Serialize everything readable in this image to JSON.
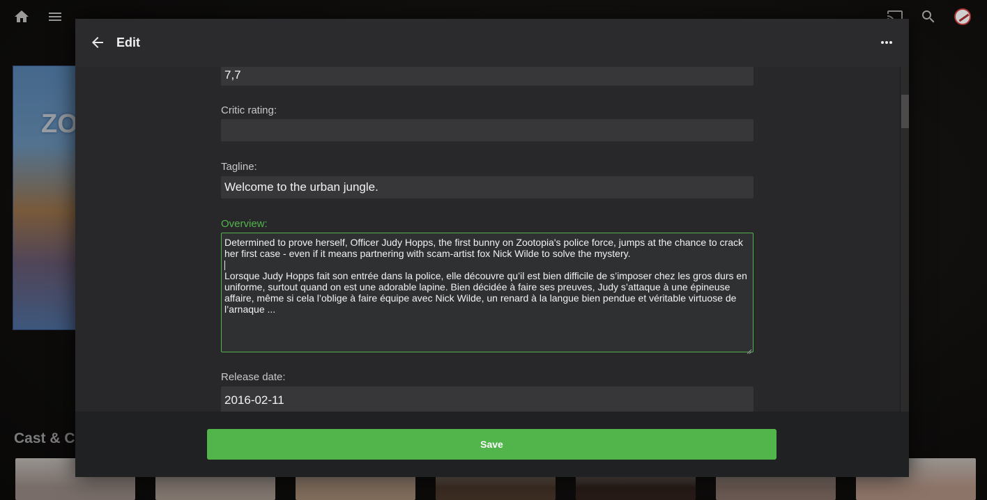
{
  "app": {
    "dialog_title": "Edit"
  },
  "background": {
    "poster_text": "ZO",
    "section_title": "Cast & Cr",
    "cast_colors": [
      "#b9a8a0",
      "#c9b7ad",
      "#c8a88e",
      "#5d4536",
      "#3b2a24",
      "#a58a80",
      "#d9b2a0"
    ]
  },
  "fields": {
    "community_rating_value": "7,7",
    "critic_rating": {
      "label": "Critic rating:",
      "value": ""
    },
    "tagline": {
      "label": "Tagline:",
      "value": "Welcome to the urban jungle."
    },
    "overview": {
      "label": "Overview:",
      "line1": "Determined to prove herself, Officer Judy Hopps, the first bunny on Zootopia's police force, jumps at the chance to crack her first case - even if it means partnering with scam-artist fox Nick Wilde to solve the mystery.",
      "line2": "Lorsque Judy Hopps fait son entrée dans la police, elle découvre qu’il est bien difficile de s’imposer chez les gros durs en uniforme, surtout quand on est une adorable lapine. Bien décidée à faire ses preuves, Judy s’attaque à une épineuse affaire, même si cela l’oblige à faire équipe avec Nick Wilde, un renard à la langue bien pendue et véritable virtuose de l’arnaque ..."
    },
    "release_date": {
      "label": "Release date:",
      "value": "2016-02-11"
    }
  },
  "footer": {
    "save_label": "Save"
  },
  "colors": {
    "accent": "#52b54b",
    "dialog_bg": "#28282a",
    "input_bg": "#373739"
  },
  "icons": {
    "home": "home-icon",
    "menu": "menu-icon",
    "cast": "cast-icon",
    "search": "search-icon",
    "back": "arrow-back-icon",
    "more": "more-horiz-icon"
  }
}
